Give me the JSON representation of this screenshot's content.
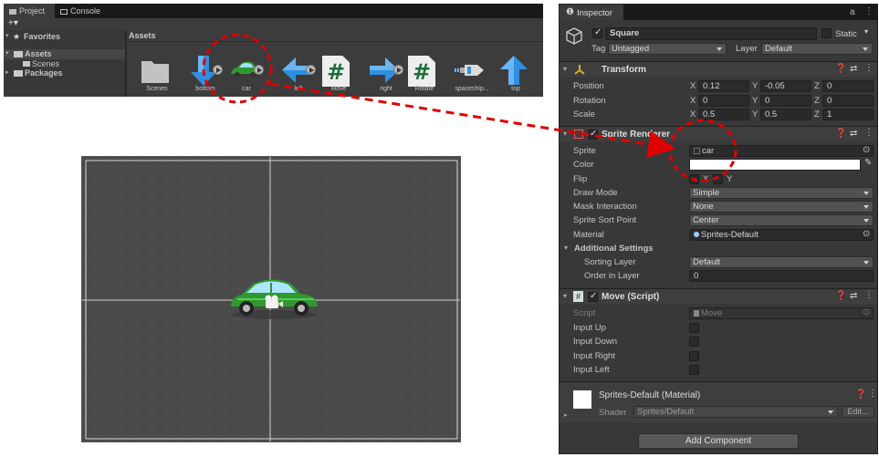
{
  "project": {
    "tabs": [
      "Project",
      "Console"
    ],
    "add_label": "+▾",
    "tree": {
      "favorites": "Favorites",
      "assets": "Assets",
      "scenes": "Scenes",
      "packages": "Packages"
    },
    "breadcrumb": "Assets",
    "assets": [
      {
        "label": "Scenes",
        "kind": "folder"
      },
      {
        "label": "bottom",
        "kind": "arrow-down"
      },
      {
        "label": "car",
        "kind": "car"
      },
      {
        "label": "left",
        "kind": "arrow-left"
      },
      {
        "label": "Move",
        "kind": "script"
      },
      {
        "label": "right",
        "kind": "arrow-right"
      },
      {
        "label": "Rotate",
        "kind": "script"
      },
      {
        "label": "spaceship...",
        "kind": "spaceship"
      },
      {
        "label": "top",
        "kind": "arrow-up"
      }
    ]
  },
  "inspector": {
    "tab": "Inspector",
    "object_name": "Square",
    "static_label": "Static",
    "tag_label": "Tag",
    "tag_value": "Untagged",
    "layer_label": "Layer",
    "layer_value": "Default",
    "transform": {
      "title": "Transform",
      "position_label": "Position",
      "rotation_label": "Rotation",
      "scale_label": "Scale",
      "x": "X",
      "y": "Y",
      "z": "Z",
      "position": [
        "0.12",
        "-0.05",
        "0"
      ],
      "rotation": [
        "0",
        "0",
        "0"
      ],
      "scale": [
        "0.5",
        "0.5",
        "1"
      ]
    },
    "sprite_renderer": {
      "title": "Sprite Renderer",
      "sprite_label": "Sprite",
      "sprite_value": "car",
      "color_label": "Color",
      "flip_label": "Flip",
      "flip_x": "X",
      "flip_y": "Y",
      "draw_mode_label": "Draw Mode",
      "draw_mode_value": "Simple",
      "mask_label": "Mask Interaction",
      "mask_value": "None",
      "sort_point_label": "Sprite Sort Point",
      "sort_point_value": "Center",
      "material_label": "Material",
      "material_value": "Sprites-Default",
      "additional_label": "Additional Settings",
      "sorting_layer_label": "Sorting Layer",
      "sorting_layer_value": "Default",
      "order_label": "Order in Layer",
      "order_value": "0"
    },
    "move_script": {
      "title": "Move (Script)",
      "script_label": "Script",
      "script_value": "Move",
      "input_up": "Input Up",
      "input_down": "Input Down",
      "input_right": "Input Right",
      "input_left": "Input Left"
    },
    "material": {
      "title": "Sprites-Default (Material)",
      "shader_label": "Shader",
      "shader_value": "Sprites/Default",
      "edit_label": "Edit..."
    },
    "add_component": "Add Component"
  },
  "colors": {
    "panel": "#383838",
    "annotation": "#e00000",
    "car_body": "#2e9a2e",
    "arrow_blue": "#2f8fe0"
  }
}
